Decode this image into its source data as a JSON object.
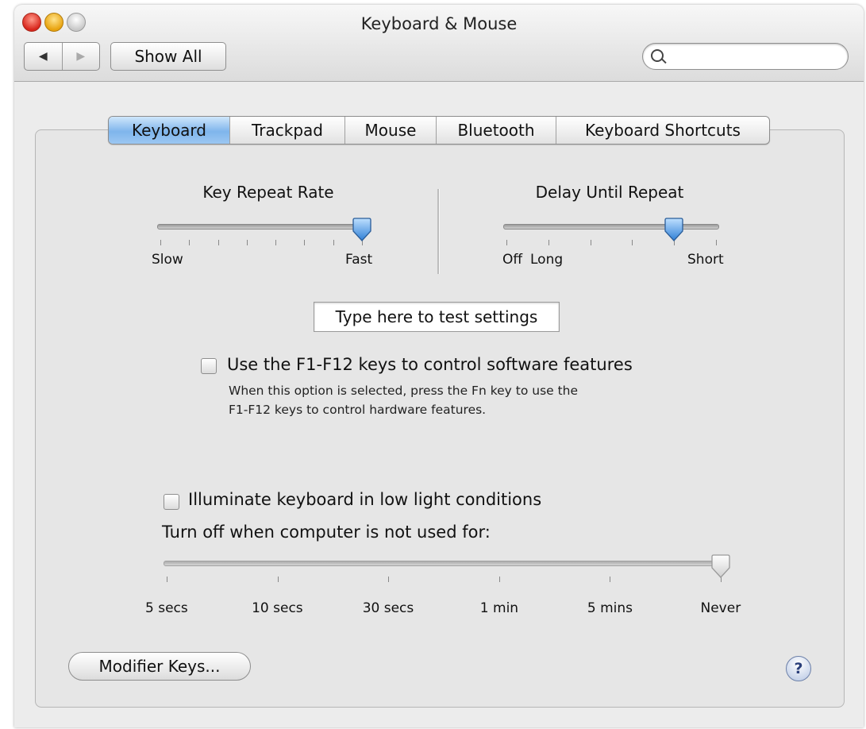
{
  "window": {
    "title": "Keyboard & Mouse"
  },
  "toolbar": {
    "back_glyph": "◀",
    "forward_glyph": "▶",
    "show_all_label": "Show All",
    "search_value": "",
    "search_icon": "magnifier-icon"
  },
  "tabs": [
    {
      "label": "Keyboard",
      "active": true
    },
    {
      "label": "Trackpad",
      "active": false
    },
    {
      "label": "Mouse",
      "active": false
    },
    {
      "label": "Bluetooth",
      "active": false
    },
    {
      "label": "Keyboard Shortcuts",
      "active": false
    }
  ],
  "key_repeat": {
    "title": "Key Repeat Rate",
    "min_label": "Slow",
    "max_label": "Fast",
    "value_fraction": 1.0,
    "tick_count": 8
  },
  "delay_repeat": {
    "title": "Delay Until Repeat",
    "off_label": "Off",
    "min_label": "Long",
    "max_label": "Short",
    "value_fraction": 0.8,
    "tick_count": 6
  },
  "test_field": {
    "placeholder": "Type here to test settings"
  },
  "fkeys": {
    "label": "Use the F1-F12 keys to control software features",
    "checked": false,
    "note_line1": "When this option is selected, press the Fn key to use the",
    "note_line2": "F1-F12 keys to control hardware features."
  },
  "illuminate": {
    "label": "Illuminate keyboard in low light conditions",
    "checked": false,
    "turn_off_label": "Turn off when computer is not used for:",
    "stops": [
      "5 secs",
      "10 secs",
      "30 secs",
      "1 min",
      "5 mins",
      "Never"
    ],
    "selected_stop": "Never",
    "enabled": false
  },
  "footer": {
    "modifier_keys_label": "Modifier Keys...",
    "help_label": "?"
  },
  "colors": {
    "active_tab": "#7fb5ec",
    "thumb_blue": "#3d8ad9",
    "close": "#d8261c",
    "minimize": "#e8a30f"
  }
}
